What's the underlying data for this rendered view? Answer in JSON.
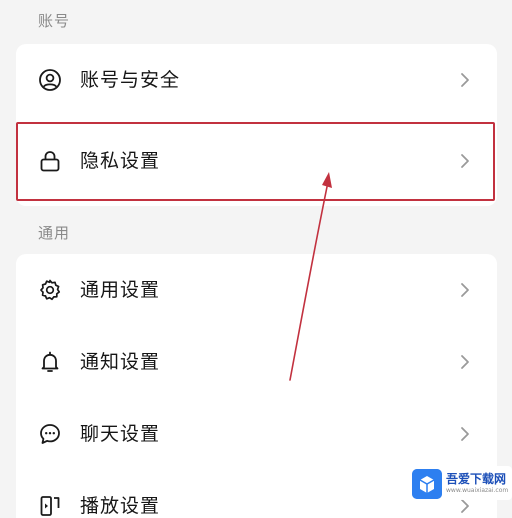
{
  "sections": {
    "account": {
      "title": "账号",
      "items": [
        {
          "label": "账号与安全",
          "icon": "user-circle-icon"
        },
        {
          "label": "隐私设置",
          "icon": "lock-icon"
        }
      ]
    },
    "general": {
      "title": "通用",
      "items": [
        {
          "label": "通用设置",
          "icon": "gear-icon"
        },
        {
          "label": "通知设置",
          "icon": "bell-icon"
        },
        {
          "label": "聊天设置",
          "icon": "chat-bubble-icon"
        },
        {
          "label": "播放设置",
          "icon": "playback-icon"
        }
      ]
    }
  },
  "annotation": {
    "highlight_color": "#c2313f",
    "highlighted_item": "隐私设置"
  },
  "watermark": {
    "title": "吾爱下载网",
    "url": "www.wuaixiazai.com"
  }
}
